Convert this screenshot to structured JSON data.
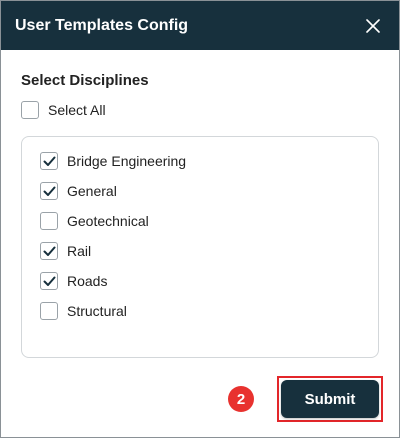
{
  "dialog": {
    "title": "User Templates Config",
    "close_icon": "close-icon"
  },
  "disciplines": {
    "section_label": "Select Disciplines",
    "select_all": {
      "label": "Select All",
      "checked": false
    },
    "items": [
      {
        "label": "Bridge Engineering",
        "checked": true
      },
      {
        "label": "General",
        "checked": true
      },
      {
        "label": "Geotechnical",
        "checked": false
      },
      {
        "label": "Rail",
        "checked": true
      },
      {
        "label": "Roads",
        "checked": true
      },
      {
        "label": "Structural",
        "checked": false
      }
    ]
  },
  "footer": {
    "step_badge": "2",
    "submit_label": "Submit"
  },
  "colors": {
    "header_bg": "#17303d",
    "badge_bg": "#e8322f",
    "highlight_border": "#e3262a"
  }
}
